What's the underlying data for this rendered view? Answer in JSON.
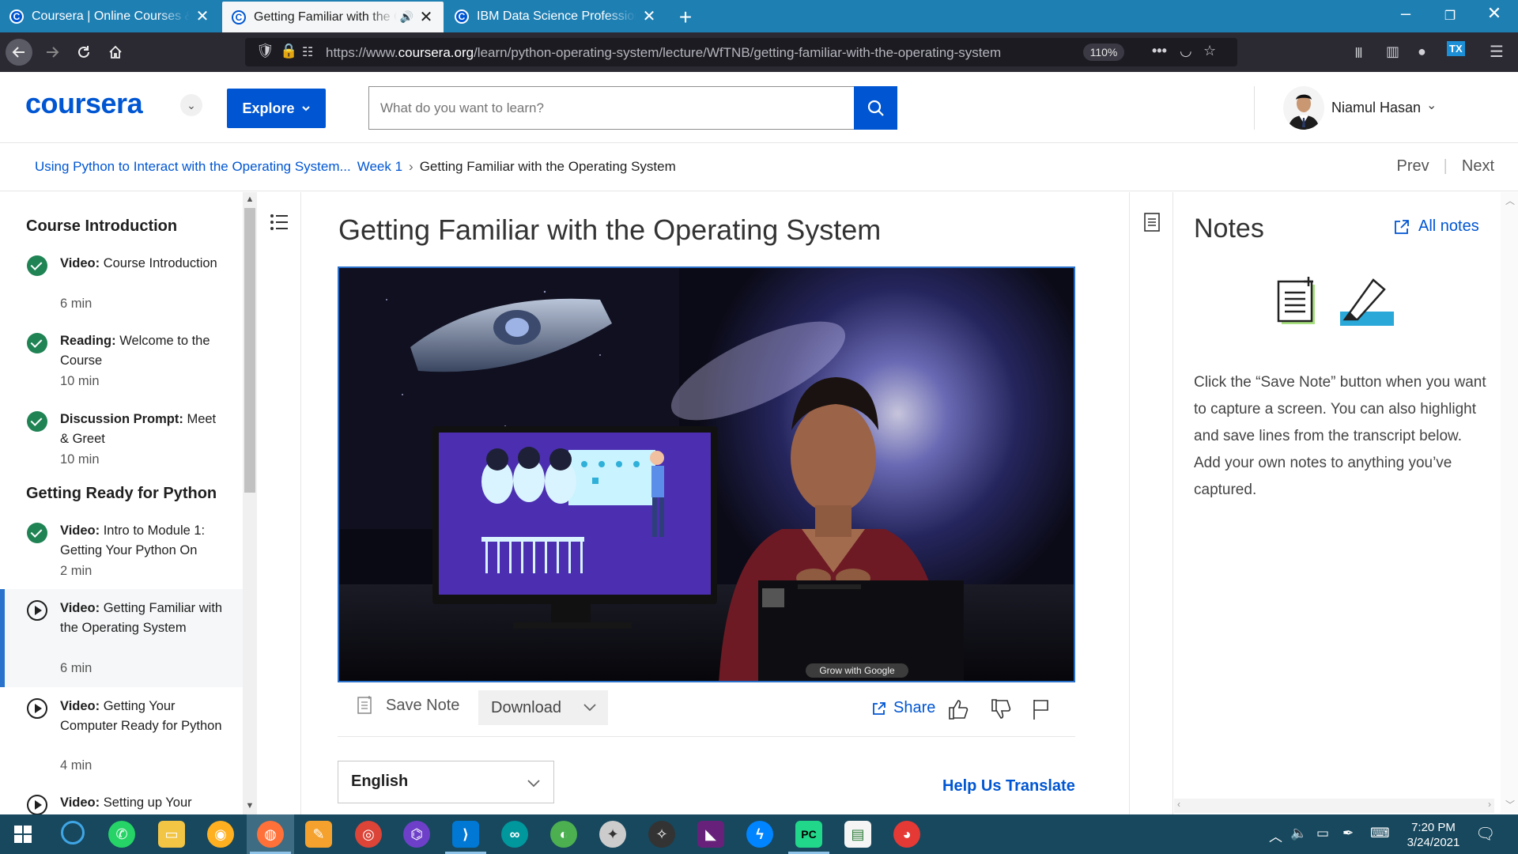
{
  "browser": {
    "tabs": [
      {
        "title": "Coursera | Online Courses & Credentials",
        "favicon": "C",
        "active": false
      },
      {
        "title": "Getting Familiar with the Operating System",
        "favicon": "C",
        "active": true
      },
      {
        "title": "IBM Data Science Professional Certificate",
        "favicon": "C",
        "active": false
      }
    ],
    "url_prefix": "https://www.",
    "url_domain": "coursera.org",
    "url_path": "/learn/python-operating-system/lecture/WfTNB/getting-familiar-with-the-operating-system",
    "zoom": "110%"
  },
  "header": {
    "logo": "coursera",
    "explore_label": "Explore",
    "search_placeholder": "What do you want to learn?",
    "user_name": "Niamul Hasan"
  },
  "breadcrumb": {
    "course": "Using Python to Interact with the Operating System...",
    "week": "Week 1",
    "current": "Getting Familiar with the Operating System",
    "prev": "Prev",
    "next": "Next"
  },
  "sidebar": {
    "section1": "Course Introduction",
    "section2": "Getting Ready for Python",
    "items": [
      {
        "kind": "Video:",
        "title": "Course Introduction",
        "duration": "6 min",
        "status": "done"
      },
      {
        "kind": "Reading:",
        "title": "Welcome to the Course",
        "duration": "10 min",
        "status": "done"
      },
      {
        "kind": "Discussion Prompt:",
        "title": "Meet & Greet",
        "duration": "10 min",
        "status": "done"
      },
      {
        "kind": "Video:",
        "title": "Intro to Module 1: Getting Your Python On",
        "duration": "2 min",
        "status": "done"
      },
      {
        "kind": "Video:",
        "title": "Getting Familiar with the Operating System",
        "duration": "6 min",
        "status": "current"
      },
      {
        "kind": "Video:",
        "title": "Getting Your Computer Ready for Python",
        "duration": "4 min",
        "status": "todo"
      },
      {
        "kind": "Video:",
        "title": "Setting up Your",
        "duration": "",
        "status": "todo"
      }
    ]
  },
  "main": {
    "lecture_title": "Getting Familiar with the Operating System",
    "video_watermark": "Grow with Google",
    "save_note": "Save Note",
    "download": "Download",
    "share": "Share",
    "language": "English",
    "help_translate": "Help Us Translate"
  },
  "notes": {
    "title": "Notes",
    "all_notes": "All notes",
    "text": "Click the “Save Note” button when you want to capture a screen. You can also highlight and save lines from the transcript below. Add your own notes to anything you’ve captured."
  },
  "taskbar": {
    "time": "7:20 PM",
    "date": "3/24/2021"
  },
  "colors": {
    "brand": "#0056d2",
    "tabbar": "#1e7fb3",
    "taskbar": "#17485e",
    "complete": "#1f8354"
  }
}
